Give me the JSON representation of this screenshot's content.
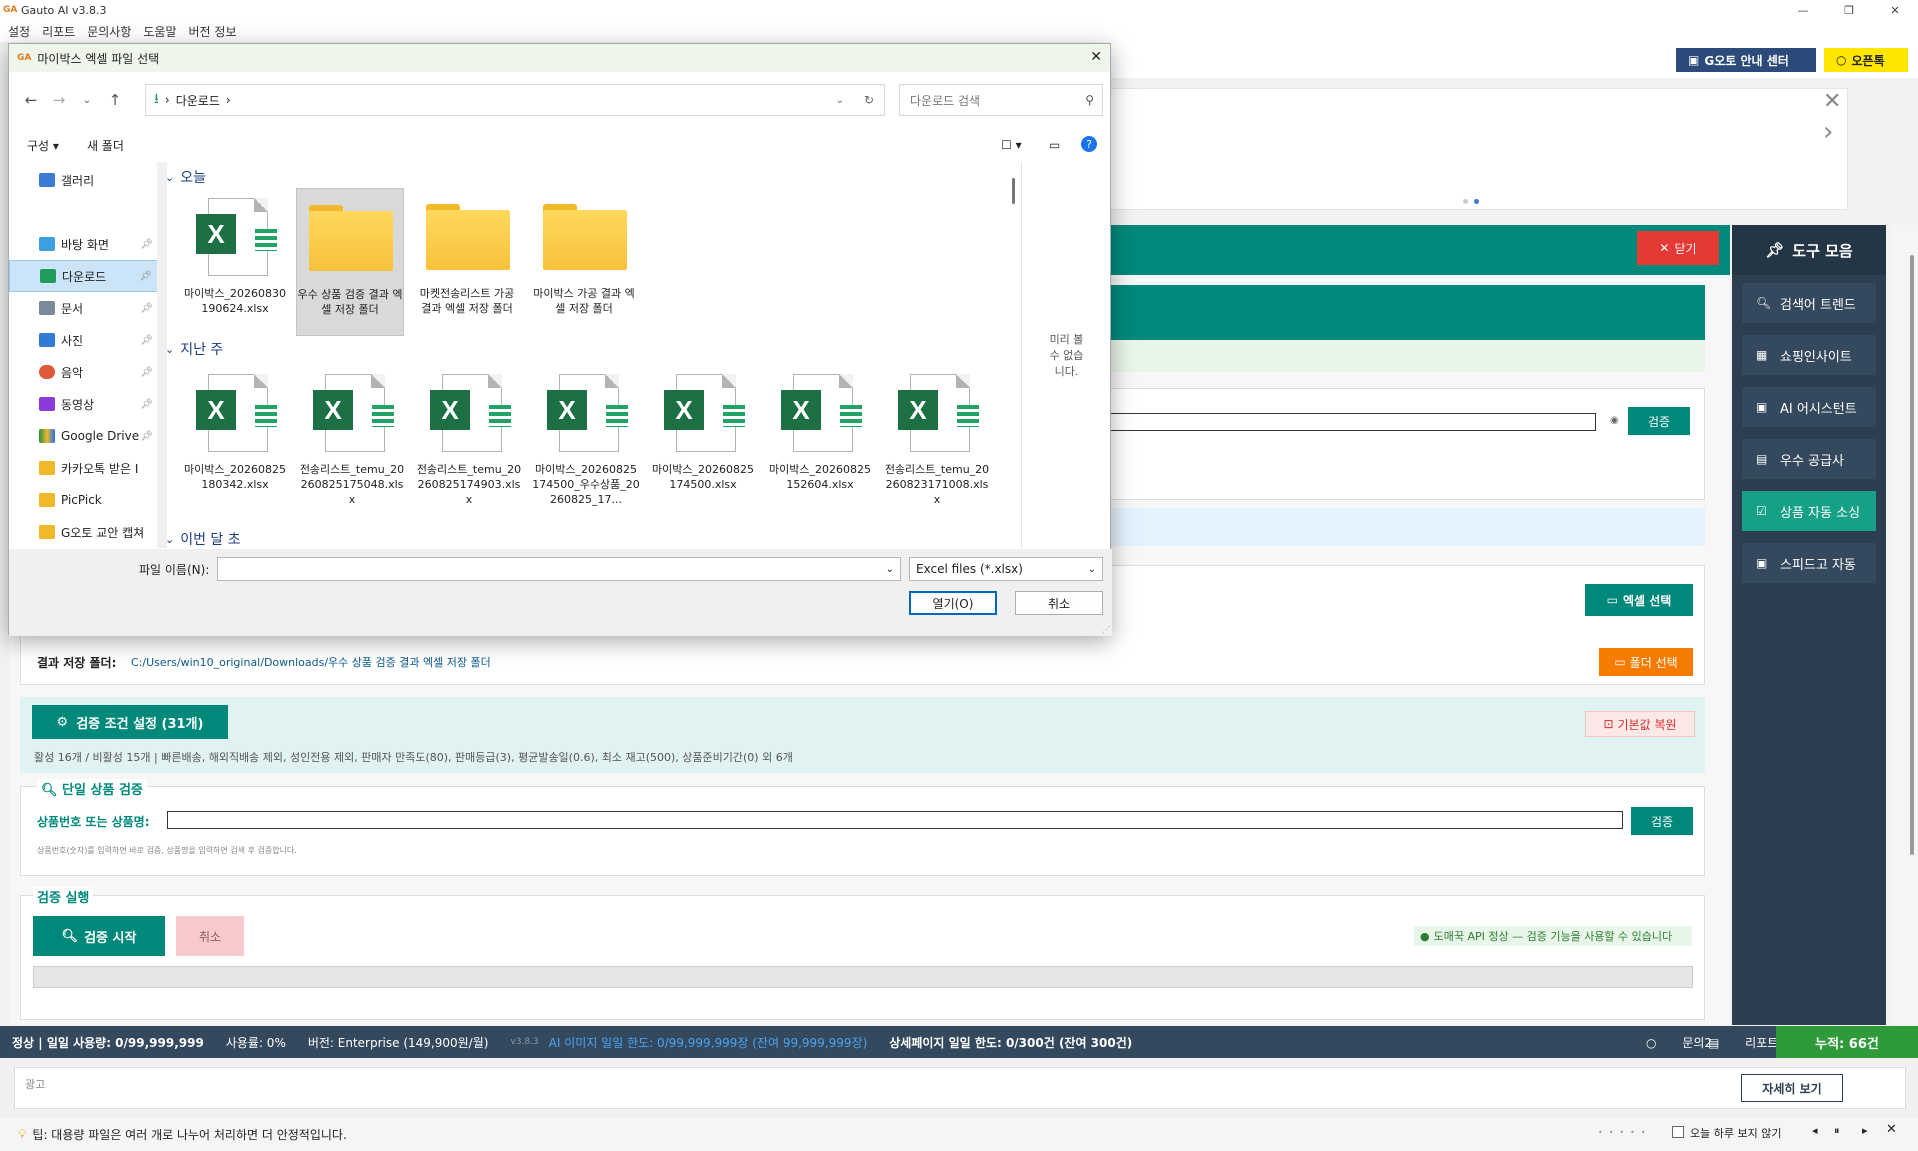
{
  "window": {
    "title": "Gauto AI v3.8.3"
  },
  "menu": [
    "설정",
    "리포트",
    "문의사항",
    "도움말",
    "버전 정보"
  ],
  "header": {
    "guide_label": "G오토 안내 센터",
    "openchat_label": "오픈톡"
  },
  "panel": {
    "close_label": "닫기",
    "verify_label": "검증",
    "excel_select_label": "엑셀 선택",
    "save_folder_label": "결과 저장 폴더:",
    "save_folder_path": "C:/Users/win10_original/Downloads/우수 상품 검증 결과 엑셀 저장 폴더",
    "folder_select_label": "폴더 선택",
    "conditions_label": "검증 조건 설정 (31개)",
    "reset_label": "기본값 복원",
    "conditions_summary": "활성 16개 / 비활성 15개 | 빠른배송, 해외직배송 제외, 성인전용 제외, 판매자 만족도(80), 판매등급(3), 평균발송일(0.6), 최소 재고(500), 상품준비기간(0) 외 6개",
    "single_title": "단일 상품 검증",
    "single_field_label": "상품번호 또는 상품명:",
    "single_verify_label": "검증",
    "single_hint": "상품번호(숫자)를 입력하면 바로 검증, 상품명을 입력하면 검색 후 검증합니다.",
    "run_title": "검증 실행",
    "start_label": "검증 시작",
    "cancel_label": "취소",
    "api_status": "도매꾹 API 정상 — 검증 기능을 사용할 수 있습니다"
  },
  "sidebar": {
    "title": "도구 모음",
    "items": [
      {
        "label": "검색어 트렌드",
        "icon": "search-icon"
      },
      {
        "label": "쇼핑인사이트",
        "icon": "chart-icon"
      },
      {
        "label": "AI 어시스턴트",
        "icon": "robot-icon"
      },
      {
        "label": "우수 공급사",
        "icon": "building-icon"
      },
      {
        "label": "상품 자동 소싱",
        "icon": "checkbox-icon"
      },
      {
        "label": "스피드고 자동",
        "icon": "robot-icon"
      }
    ]
  },
  "status": {
    "daily_usage": "정상 | 일일 사용량: 0/99,999,999",
    "usage_rate": "사용률: 0%",
    "version": "버전: Enterprise (149,900원/월)",
    "build": "v3.8.3",
    "ai_limit": "AI 이미지 일일 한도: 0/99,999,999장 (잔여 99,999,999장)",
    "detail_limit": "상세페이지 일일 한도: 0/300건 (잔여 300건)",
    "inquiry": "문의2",
    "report": "리포트",
    "total": "누적: 66건"
  },
  "ad": {
    "label": "광고",
    "detail_label": "자세히 보기"
  },
  "tip": {
    "text": "팁: 대용량 파일은 여러 개로 나누어 처리하면 더 안정적입니다.",
    "hide_today": "오늘 하루 보지 않기"
  },
  "dialog": {
    "title": "마이박스 엑셀 파일 선택",
    "breadcrumb": "다운로드",
    "search_placeholder": "다운로드 검색",
    "organize_label": "구성",
    "new_folder_label": "새 폴더",
    "nav": [
      {
        "label": "갤러리",
        "color": "#3b7bd6"
      },
      {
        "label": "바탕 화면",
        "color": "#3aa0e0"
      },
      {
        "label": "다운로드",
        "color": "#1f9d5c"
      },
      {
        "label": "문서",
        "color": "#7a8a99"
      },
      {
        "label": "사진",
        "color": "#2f7bd6"
      },
      {
        "label": "음악",
        "color": "#e0593a"
      },
      {
        "label": "동영상",
        "color": "#8a3ad6"
      },
      {
        "label": "Google Drive",
        "color": "#f2b82c"
      },
      {
        "label": "카카오톡 받은 I",
        "color": "#f2b82c"
      },
      {
        "label": "PicPick",
        "color": "#f2b82c"
      },
      {
        "label": "G오토 교안 캡쳐",
        "color": "#f2b82c"
      }
    ],
    "groups": {
      "today": "오늘",
      "last_week": "지난 주",
      "this_month": "이번 달 초"
    },
    "today_files": [
      {
        "name": "마이박스_20260830190624.xlsx",
        "type": "xlsx"
      },
      {
        "name": "우수 상품 검증 결과 엑셀 저장 폴더",
        "type": "folder"
      },
      {
        "name": "마켓전송리스트 가공 결과 엑셀 저장 폴더",
        "type": "folder"
      },
      {
        "name": "마이박스 가공 결과 엑셀 저장 폴더",
        "type": "folder"
      }
    ],
    "week_files": [
      {
        "name": "마이박스_20260825180342.xlsx"
      },
      {
        "name": "전송리스트_temu_20260825175048.xlsx"
      },
      {
        "name": "전송리스트_temu_20260825174903.xlsx"
      },
      {
        "name": "마이박스_20260825174500_우수상품_20260825_17..."
      },
      {
        "name": "마이박스_20260825174500.xlsx"
      },
      {
        "name": "마이박스_20260825152604.xlsx"
      },
      {
        "name": "전송리스트_temu_20260823171008.xlsx"
      }
    ],
    "preview_text": "미리 볼 수 없습니다.",
    "filename_label": "파일 이름(N):",
    "filetype": "Excel files (*.xlsx)",
    "open_label": "열기(O)",
    "cancel_label": "취소"
  }
}
